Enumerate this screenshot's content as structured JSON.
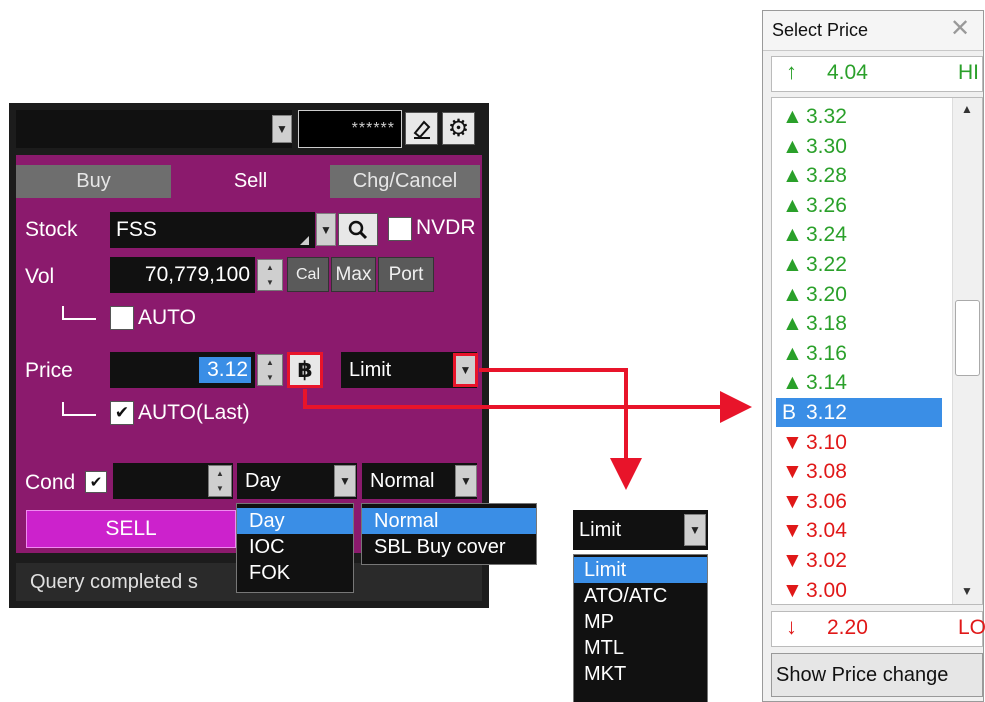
{
  "panel": {
    "password_mask": "******",
    "tabs": [
      "Buy",
      "Sell",
      "Chg/Cancel"
    ],
    "stock_label": "Stock",
    "stock_value": "FSS",
    "nvdr_label": "NVDR",
    "vol_label": "Vol",
    "vol_value": "70,779,100",
    "cal_label": "Cal",
    "max_label": "Max",
    "port_label": "Port",
    "auto_label": "AUTO",
    "price_label": "Price",
    "price_value": "3.12",
    "baht_icon": "฿",
    "price_type": "Limit",
    "auto_last_label": "AUTO(Last)",
    "cond_label": "Cond",
    "validity": "Day",
    "order_kind": "Normal",
    "sell_label": "SELL",
    "status": "Query completed s"
  },
  "validity_options": [
    "Day",
    "IOC",
    "FOK"
  ],
  "order_kind_options": [
    "Normal",
    "SBL Buy cover"
  ],
  "price_type_box": {
    "selected": "Limit",
    "options": [
      "Limit",
      "ATO/ATC",
      "MP",
      "MTL",
      "MKT"
    ]
  },
  "price_window": {
    "title": "Select Price",
    "high": {
      "arrow": "↑",
      "value": "4.04",
      "tag": "HI"
    },
    "prices_up": [
      "3.32",
      "3.30",
      "3.28",
      "3.26",
      "3.24",
      "3.22",
      "3.20",
      "3.18",
      "3.16",
      "3.14"
    ],
    "current": {
      "marker": "B",
      "value": "3.12"
    },
    "prices_down": [
      "3.10",
      "3.08",
      "3.06",
      "3.04",
      "3.02",
      "3.00"
    ],
    "low": {
      "arrow": "↓",
      "value": "2.20",
      "tag": "LO"
    },
    "show_change_label": "Show Price change"
  },
  "colors": {
    "panel_bg": "#8b1a6d",
    "sell": "#cc22cc",
    "highlight": "#3a8ee6",
    "connector": "#e8142a",
    "up": "#2aa02a",
    "down": "#e01818"
  }
}
